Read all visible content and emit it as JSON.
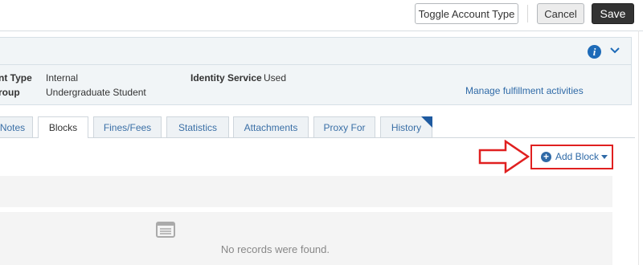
{
  "toolbar": {
    "toggle_label": "Toggle Account Type",
    "cancel_label": "Cancel",
    "save_label": "Save"
  },
  "info_panel": {
    "row1_label": "nt Type",
    "row1_value": "Internal",
    "row2_label": "roup",
    "row2_value": "Undergraduate Student",
    "identity_label": "Identity Service",
    "identity_value": "Used",
    "manage_link": "Manage fulfillment activities",
    "info_icon": "info-icon",
    "chevron_icon": "chevron-down-icon",
    "accent_color": "#1e6bb8"
  },
  "tabs": [
    {
      "label": "Notes"
    },
    {
      "label": "Blocks"
    },
    {
      "label": "Fines/Fees"
    },
    {
      "label": "Statistics"
    },
    {
      "label": "Attachments"
    },
    {
      "label": "Proxy For"
    },
    {
      "label": "History"
    }
  ],
  "active_tab": "Blocks",
  "content": {
    "add_block_label": "Add Block",
    "add_icon": "plus-circle-icon",
    "empty_message": "No records were found.",
    "empty_icon": "list-icon",
    "highlight_color": "#e02020"
  }
}
